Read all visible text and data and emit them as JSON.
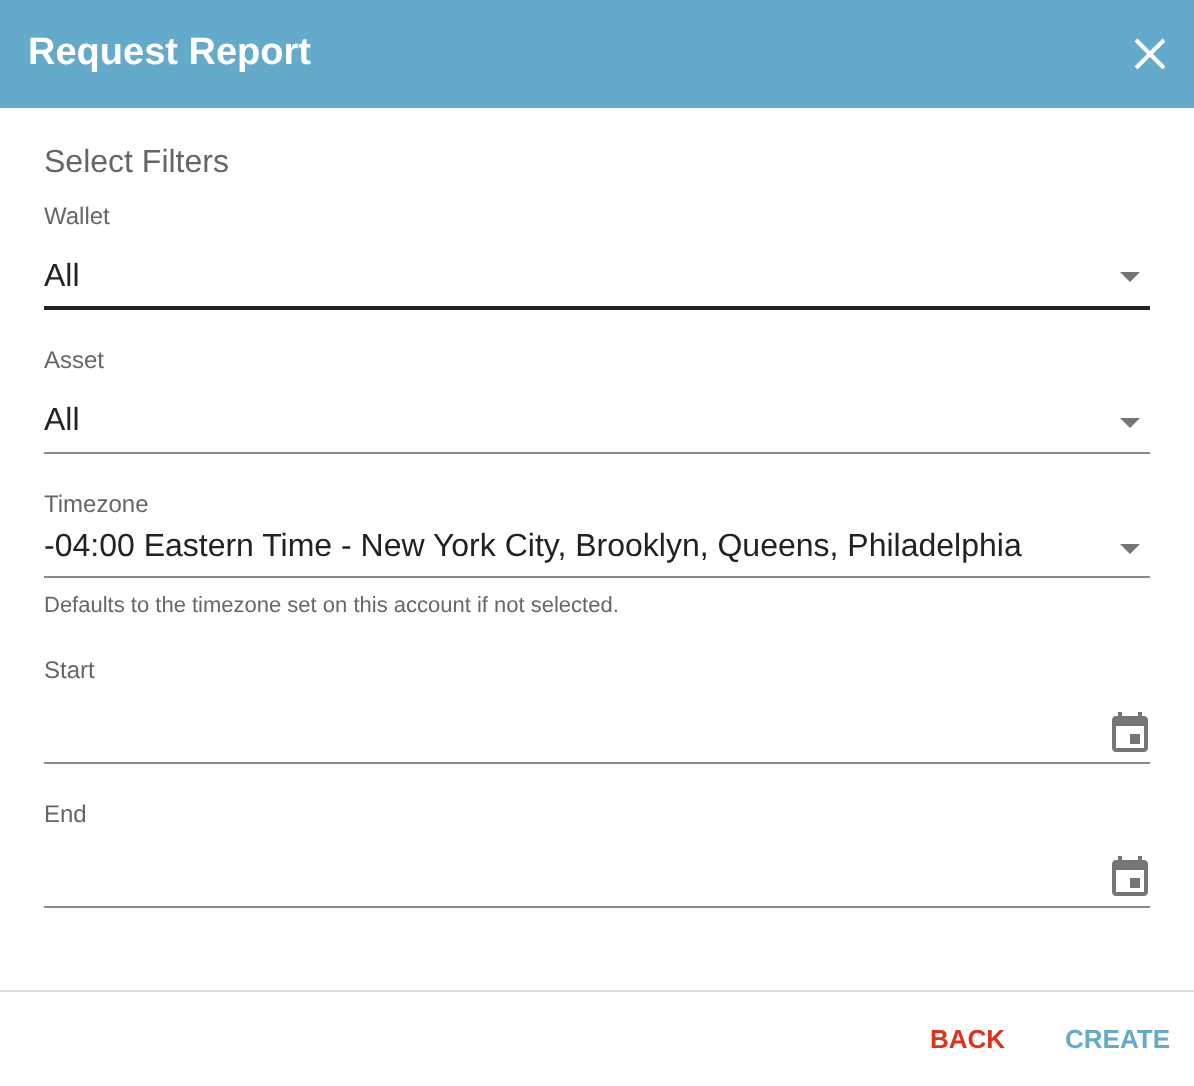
{
  "dialog": {
    "title": "Request Report"
  },
  "section_title": "Select Filters",
  "fields": [
    {
      "kind": "select",
      "label": "Wallet",
      "value": "All",
      "focused": true
    },
    {
      "kind": "select",
      "label": "Asset",
      "value": "All",
      "focused": false
    },
    {
      "kind": "select",
      "label": "Timezone",
      "value": "-04:00 Eastern Time - New York City, Brooklyn, Queens, Philadelphia",
      "focused": false,
      "helper": "Defaults to the timezone set on this account if not selected."
    },
    {
      "kind": "date",
      "label": "Start",
      "focused": false
    },
    {
      "kind": "date",
      "label": "End",
      "focused": false
    }
  ],
  "buttons": [
    {
      "kind": "danger",
      "label": "BACK"
    },
    {
      "kind": "primary",
      "label": "CREATE"
    }
  ]
}
